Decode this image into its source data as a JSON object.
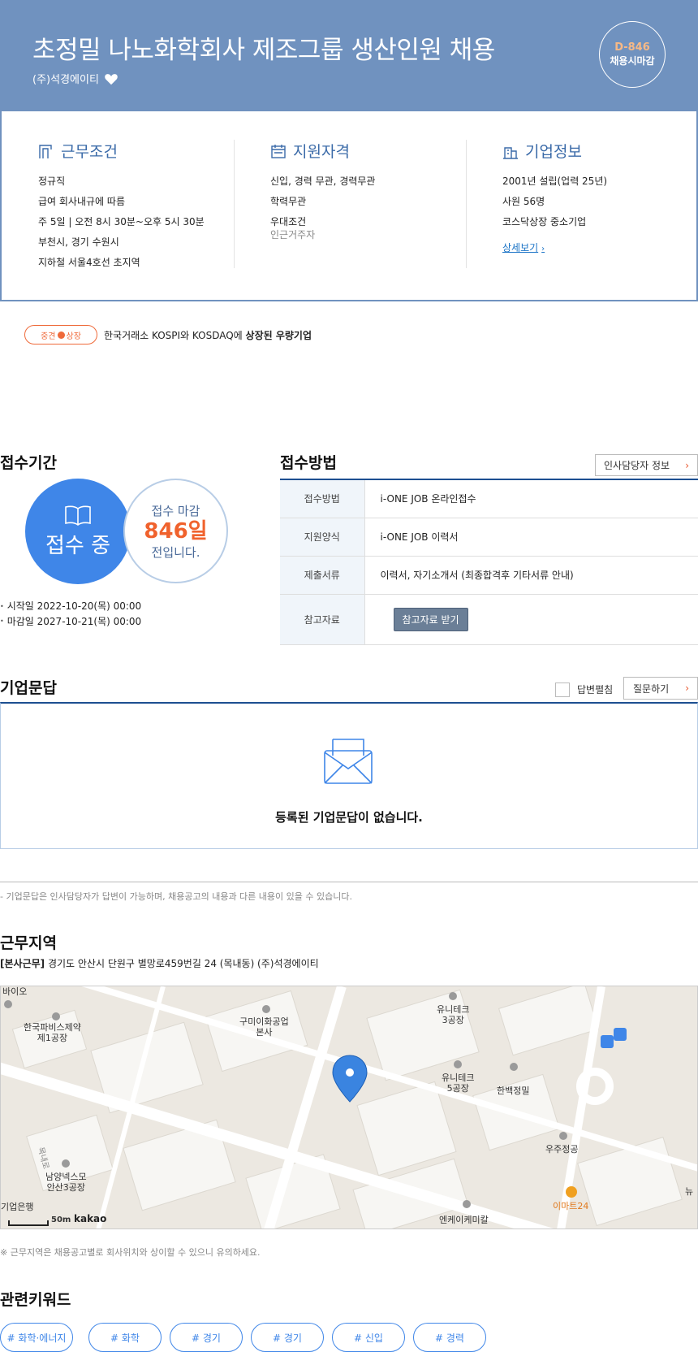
{
  "header": {
    "title": "초정밀 나노화학회사 제조그룹 생산인원 채용",
    "company": "(주)석경에이티",
    "dday": "D-846",
    "dday_label": "채용시마감"
  },
  "work_conditions": {
    "title": "근무조건",
    "items": [
      "정규직",
      "급여 회사내규에 따름",
      "주 5일 | 오전 8시 30분~오후 5시 30분",
      "부천시, 경기 수원시",
      "지하철 서울4호선 초지역"
    ]
  },
  "qualifications": {
    "title": "지원자격",
    "items": [
      "신입, 경력 무관, 경력무관",
      "학력무관",
      "우대조건"
    ],
    "preferred_detail": "인근거주자"
  },
  "company_info": {
    "title": "기업정보",
    "items": [
      "2001년 설립(업력 25년)",
      "사원 56명",
      "코스닥상장 중소기업"
    ],
    "more_label": "상세보기",
    "more_arrow": "›"
  },
  "badge": {
    "left": "중견",
    "right": "상장"
  },
  "tagline": {
    "normal": "한국거래소 KOSPI와 KOSDAQ에 ",
    "bold": "상장된 우량기업"
  },
  "period": {
    "title": "접수기간",
    "status": "접수 중",
    "deadline_line1": "접수 마감",
    "deadline_days": "846일",
    "deadline_line3": "전입니다.",
    "start": "시작일 2022-10-20(목) 00:00",
    "end": "마감일 2027-10-21(목) 00:00"
  },
  "method": {
    "title": "접수방법",
    "hr_button": "인사담당자 정보",
    "arrow": "›",
    "rows": [
      {
        "key": "접수방법",
        "value": "i-ONE JOB 온라인접수"
      },
      {
        "key": "지원양식",
        "value": "i-ONE JOB 이력서"
      },
      {
        "key": "제출서류",
        "value": "이력서, 자기소개서 (최종합격후 기타서류 안내)"
      },
      {
        "key": "참고자료",
        "value": "참고자료 받기"
      }
    ]
  },
  "qa": {
    "title": "기업문답",
    "checkbox_label": "답변펼침",
    "ask_button": "질문하기",
    "empty": "등록된 기업문답이 없습니다.",
    "note": "- 기업문답은 인사담당자가 답변이 가능하며, 채용공고의 내용과 다른 내용이 있을 수 있습니다."
  },
  "location": {
    "title": "근무지역",
    "tag": "[본사근무]",
    "address": " 경기도 안산시 단원구 별망로459번길 24 (목내동) (주)석경에이티",
    "note": "※ 근무지역은 채용공고별로 회사위치와 상이할 수 있으니 유의하세요.",
    "map_labels": [
      "바이오",
      "한국파비스제약\n제1공장",
      "구미이화공업\n본사",
      "유니테크\n3공장",
      "유니테크\n5공장",
      "한백정밀",
      "우주정공",
      "남양넥스모\n안산3공장",
      "이마트24",
      "기업은행",
      "엔케이케미칼",
      "뉴",
      "목내로"
    ],
    "scale": "50m",
    "provider": "kakao"
  },
  "keywords": {
    "title": "관련키워드",
    "items": [
      "# 화학·에너지",
      "# 화학",
      "# 경기",
      "# 경기",
      "# 신입",
      "# 경력"
    ]
  },
  "colors": {
    "header_bg": "#7092bf",
    "accent_blue": "#3f86e8",
    "accent_orange": "#f0622d",
    "navy": "#1d4f91"
  }
}
